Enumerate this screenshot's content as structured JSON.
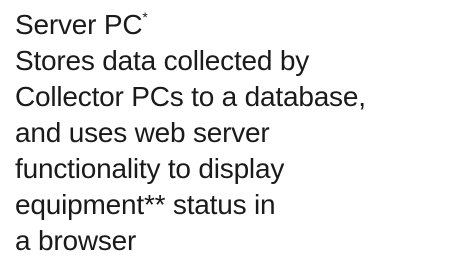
{
  "heading": {
    "title": "Server PC",
    "title_mark": "*"
  },
  "description": {
    "lines": [
      "Stores data collected by",
      "Collector PCs to a database,",
      "and uses web server",
      "functionality to display",
      "equipment** status in",
      "a browser"
    ]
  }
}
